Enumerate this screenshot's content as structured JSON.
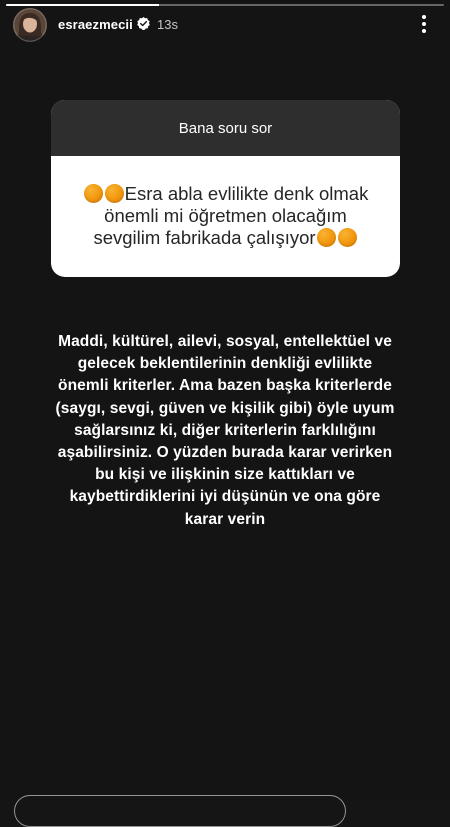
{
  "story": {
    "progress": 0.35
  },
  "header": {
    "username": "esraezmecii",
    "time": "13s",
    "avatar_icon": "profile-photo",
    "verified_icon": "verified-badge-icon",
    "more_icon": "more-vertical-icon"
  },
  "question_card": {
    "title": "Bana soru sor",
    "emoji_name": "orange-circle-emoji",
    "emoji_color": "#f39c12",
    "lines": [
      "Esra abla evlilikte denk olmak",
      "önemli mi öğretmen olacağım",
      "sevgilim fabrikada çalışıyor"
    ]
  },
  "answer": {
    "lines": [
      "Maddi, kültürel, ailevi, sosyal, entellektüel ve",
      "gelecek beklentilerinin denkliği evlilikte",
      "önemli kriterler. Ama bazen başka kriterlerde",
      "(saygı, sevgi, güven ve kişilik gibi) öyle uyum",
      "sağlarsınız ki, diğer kriterlerin farklılığını",
      "aşabilirsiniz. O yüzden burada karar verirken",
      "bu kişi ve ilişkinin size kattıkları ve",
      "kaybettirdiklerini iyi düşünün ve ona göre",
      "karar verin"
    ]
  }
}
